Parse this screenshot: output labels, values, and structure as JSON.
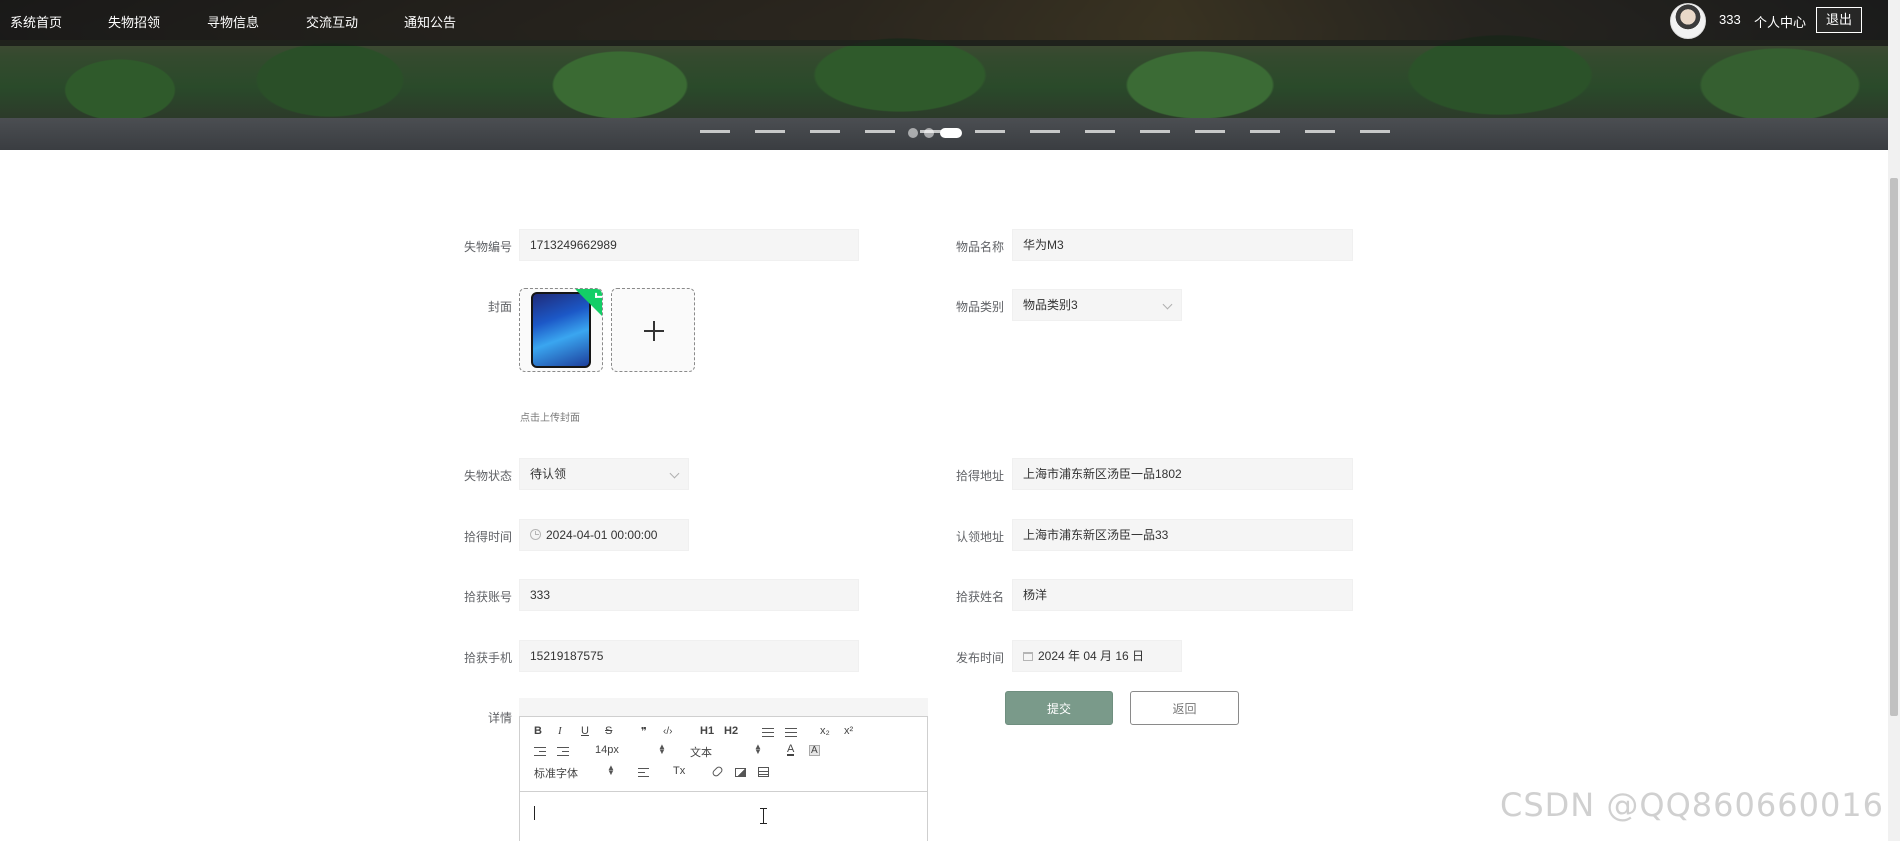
{
  "nav": {
    "items": [
      "系统首页",
      "失物招领",
      "寻物信息",
      "交流互动",
      "通知公告"
    ],
    "username": "333",
    "profile_label": "个人中心",
    "logout_label": "退出"
  },
  "carousel": {
    "slide_count": 3,
    "active_index": 2
  },
  "form": {
    "lost_id": {
      "label": "失物编号",
      "value": "1713249662989"
    },
    "item_name": {
      "label": "物品名称",
      "value": "华为M3"
    },
    "cover": {
      "label": "封面",
      "upload_tip": "点击上传封面"
    },
    "item_category": {
      "label": "物品类别",
      "value": "物品类别3"
    },
    "lost_status": {
      "label": "失物状态",
      "value": "待认领"
    },
    "found_address": {
      "label": "拾得地址",
      "value": "上海市浦东新区汤臣一品1802"
    },
    "found_time": {
      "label": "拾得时间",
      "value": "2024-04-01 00:00:00"
    },
    "claim_address": {
      "label": "认领地址",
      "value": "上海市浦东新区汤臣一品33"
    },
    "finder_account": {
      "label": "拾获账号",
      "value": "333"
    },
    "finder_name": {
      "label": "拾获姓名",
      "value": "杨洋"
    },
    "finder_phone": {
      "label": "拾获手机",
      "value": "15219187575"
    },
    "publish_time": {
      "label": "发布时间",
      "value": "2024 年 04 月 16 日"
    },
    "details": {
      "label": "详情"
    }
  },
  "buttons": {
    "submit": "提交",
    "back": "返回"
  },
  "editor": {
    "font_size": "14px",
    "heading": "文本",
    "font_family": "标准字体",
    "h1": "H1",
    "h2": "H2",
    "sub": "x₂",
    "sup": "x²",
    "bold": "B",
    "italic": "I",
    "underline": "U",
    "strike": "S",
    "quote": "❞",
    "code": "‹/›",
    "clean": "Tx",
    "color": "A",
    "background": "A"
  },
  "watermark": "CSDN @QQ860660016",
  "colors": {
    "submit_bg": "#7a9a8a",
    "upload_success": "#13ce66",
    "nav_bg": "rgba(20,20,20,.72)"
  }
}
